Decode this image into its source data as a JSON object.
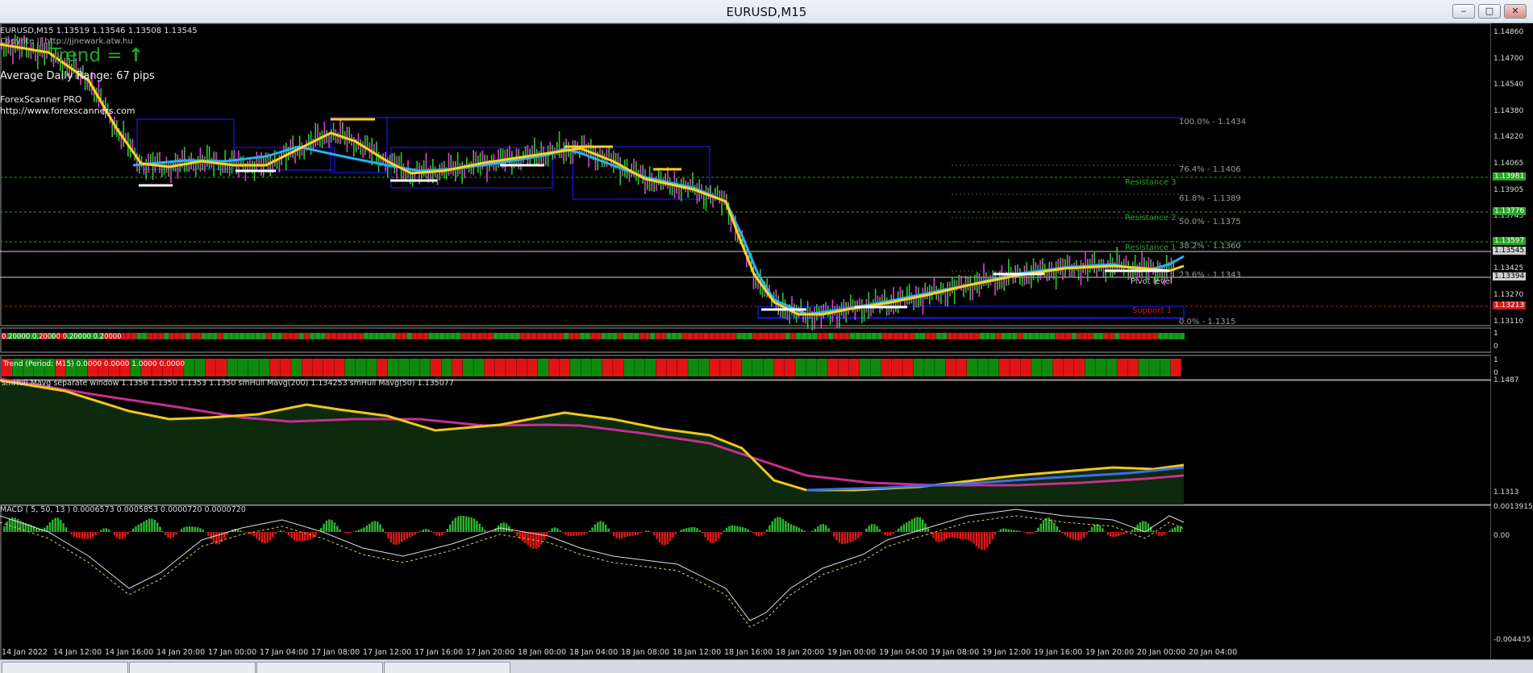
{
  "window": {
    "title": "EURUSD,M15",
    "btn_min": "‒",
    "btn_max": "□",
    "btn_close": "✕"
  },
  "main_panel": {
    "symbol_line": "EURUSD,M15  1.13519 1.13546 1.13508 1.13545",
    "link_line": "Copyrite || http://jjnewark.atw.hu",
    "trend_label": "Trend =",
    "trend_arrow": "↑",
    "adr_label": "Average Daily Range: 67 pips",
    "scanner_name": "ForexScanner PRO",
    "scanner_url": "http://www.forexscanners.com",
    "fib_levels": [
      "100.0% - 1.1434",
      "76.4% - 1.1406",
      "61.8% - 1.1389",
      "50.0% - 1.1375",
      "38.2% - 1.1360",
      "23.6% - 1.1343",
      "0.0% - 1.1315"
    ],
    "sr_labels": [
      "Resistance 3",
      "Resistance 2",
      "Resistance 1",
      "Pivot level",
      "Support 1"
    ],
    "price_ticks": [
      "1.14860",
      "1.14700",
      "1.14540",
      "1.14380",
      "1.14220",
      "1.14065",
      "1.13905",
      "1.13745",
      "1.13585",
      "1.13425",
      "1.13270",
      "1.13110"
    ],
    "price_tags": [
      "1.13981",
      "1.13776",
      "1.13597",
      "1.13545",
      "1.13394",
      "1.13213"
    ],
    "colors": {
      "bull": "#33c233",
      "bear": "#e43bd9",
      "ma_yellow": "#ffd21f",
      "ma_blue": "#23b4f5",
      "channel": "#1515c8",
      "magenta_line": "#c42f91",
      "support": "#d01a1a",
      "resistance": "#24a524"
    }
  },
  "strip1": {
    "label": "0.20000 0.20000 0.20000 0.20000",
    "axis_top": "1",
    "axis_bottom": "0"
  },
  "strip2": {
    "label": "Trend (Period: M15) 0.0000 0.0000 1.0000 0.0000",
    "axis_top": "1",
    "axis_bottom": "0"
  },
  "hull_panel": {
    "label": "smHull Mavg separate window 1.1356 1.1350 1.1353 1.1350  smHull Mavg(200) 1.134253  smHull Mavg(50) 1.135077",
    "axis_top": "1.1487",
    "axis_bottom": "1.1313"
  },
  "macd_panel": {
    "label": "MACD ( 5, 50, 13 ) 0.0006573 0.0005853 0.0000720 0.0000720",
    "axis_top": "0.0013915",
    "axis_mid": "0.00",
    "axis_bottom": "-0.004435"
  },
  "time_axis": [
    "14 Jan 2022",
    "14 Jan 12:00",
    "14 Jan 16:00",
    "14 Jan 20:00",
    "17 Jan 00:00",
    "17 Jan 04:00",
    "17 Jan 08:00",
    "17 Jan 12:00",
    "17 Jan 16:00",
    "17 Jan 20:00",
    "18 Jan 00:00",
    "18 Jan 04:00",
    "18 Jan 08:00",
    "18 Jan 12:00",
    "18 Jan 16:00",
    "18 Jan 20:00",
    "19 Jan 00:00",
    "19 Jan 04:00",
    "19 Jan 08:00",
    "19 Jan 12:00",
    "19 Jan 16:00",
    "19 Jan 20:00",
    "20 Jan 00:00",
    "20 Jan 04:00"
  ]
}
